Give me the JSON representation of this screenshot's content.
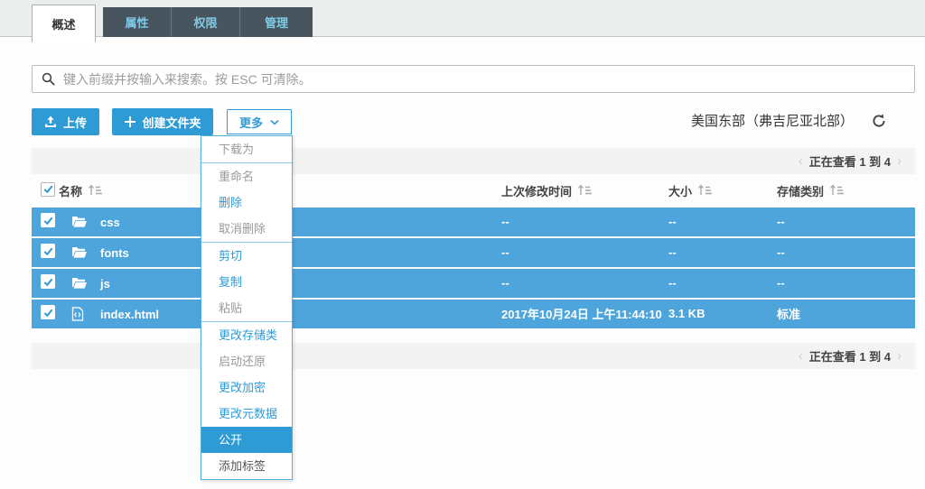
{
  "tabs": {
    "items": [
      {
        "label": "概述"
      },
      {
        "label": "属性"
      },
      {
        "label": "权限"
      },
      {
        "label": "管理"
      }
    ]
  },
  "search": {
    "placeholder": "键入前缀并按输入来搜索。按 ESC 可清除。"
  },
  "toolbar": {
    "upload_label": "上传",
    "create_folder_label": "创建文件夹",
    "more_label": "更多",
    "region": "美国东部（弗吉尼亚北部）"
  },
  "pagination": {
    "viewing_text": "正在查看 1 到 4",
    "prev": "‹",
    "next": "›"
  },
  "table": {
    "columns": [
      {
        "label": "名称"
      },
      {
        "label": "上次修改时间"
      },
      {
        "label": "大小"
      },
      {
        "label": "存储类别"
      }
    ],
    "rows": [
      {
        "name": "css",
        "type": "folder",
        "modified": "--",
        "size": "--",
        "storage_class": "--"
      },
      {
        "name": "fonts",
        "type": "folder",
        "modified": "--",
        "size": "--",
        "storage_class": "--"
      },
      {
        "name": "js",
        "type": "folder",
        "modified": "--",
        "size": "--",
        "storage_class": "--"
      },
      {
        "name": "index.html",
        "type": "file",
        "modified": "2017年10月24日 上午11:44:10",
        "size": "3.1 KB",
        "storage_class": "标准"
      }
    ]
  },
  "menu": {
    "items": [
      {
        "label": "下载为",
        "state": "disabled"
      },
      {
        "label": "重命名",
        "state": "disabled"
      },
      {
        "label": "删除",
        "state": "enabled"
      },
      {
        "label": "取消删除",
        "state": "disabled"
      },
      {
        "label": "剪切",
        "state": "enabled"
      },
      {
        "label": "复制",
        "state": "enabled"
      },
      {
        "label": "粘贴",
        "state": "disabled"
      },
      {
        "label": "更改存储类",
        "state": "enabled"
      },
      {
        "label": "启动还原",
        "state": "disabled"
      },
      {
        "label": "更改加密",
        "state": "enabled"
      },
      {
        "label": "更改元数据",
        "state": "enabled"
      },
      {
        "label": "公开",
        "state": "highlight"
      },
      {
        "label": "添加标签",
        "state": "normal"
      }
    ]
  },
  "colors": {
    "accent_blue": "#2e9bd5",
    "row_blue": "#4da5dc",
    "tab_bg": "#48545e",
    "tab_text": "#7fcbe8",
    "disabled_gray": "#999999"
  }
}
